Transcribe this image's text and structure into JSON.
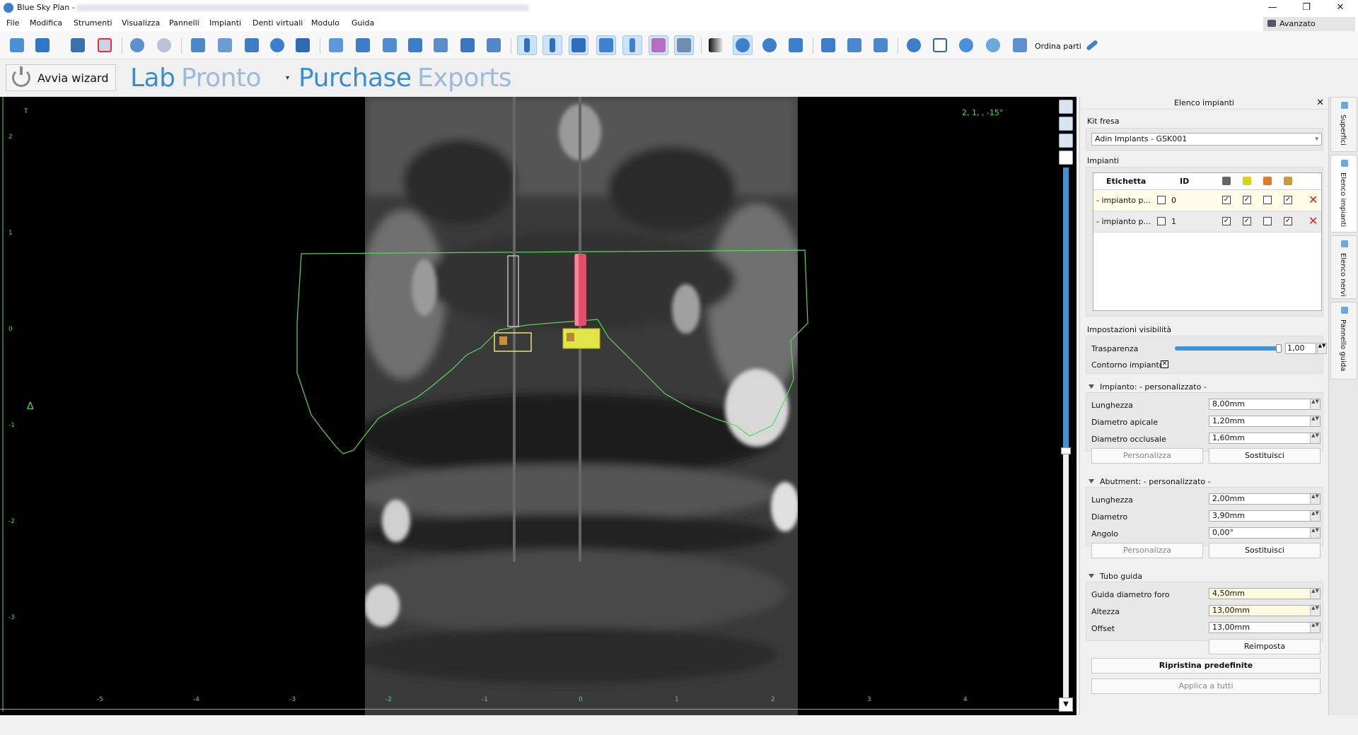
{
  "window": {
    "title": "Blue Sky Plan -",
    "minimize_glyph": "—",
    "restore_glyph": "❐",
    "close_glyph": "✕"
  },
  "menu": [
    "File",
    "Modifica",
    "Strumenti",
    "Visualizza",
    "Pannelli",
    "Impianti",
    "Denti virtuali",
    "Modulo",
    "Guida"
  ],
  "avanzato_label": "Avanzato",
  "toolbar": {
    "ordina_label": "Ordina parti"
  },
  "wizard": {
    "label": "Avvia wizard"
  },
  "brands": {
    "labpronto_a": "Lab",
    "labpronto_b": "Pronto",
    "purchase_a": "Purchase",
    "purchase_b": "Exports"
  },
  "viewport": {
    "view_label": "2, 1, , -15°",
    "axis_left_labels": [
      "2",
      "1",
      "0",
      "-1",
      "-2",
      "-3"
    ],
    "axis_left_top": "T",
    "axis_bottom_labels": [
      "-5",
      "-4",
      "-3",
      "-2",
      "-1",
      "0",
      "1",
      "2",
      "3",
      "4"
    ],
    "delta_marker": "Δ",
    "scroll_down_glyph": "▼",
    "accent_color": "#57d957"
  },
  "panel": {
    "title": "Elenco impianti",
    "close_glyph": "✕",
    "kit_label": "Kit fresa",
    "kit_value": "Adin Implants - GSK001",
    "impianti_label": "Impianti",
    "table_headers": {
      "label": "Etichetta",
      "id": "ID"
    },
    "implants": [
      {
        "label": "- impianto p...",
        "id": "0",
        "id_checked": false,
        "flags": [
          true,
          true,
          false,
          true
        ]
      },
      {
        "label": "- impianto p...",
        "id": "1",
        "id_checked": false,
        "flags": [
          true,
          true,
          false,
          true
        ]
      }
    ],
    "visibility_title": "Impostazioni visibilità",
    "trasparenza_label": "Trasparenza",
    "trasparenza_value": "1,00",
    "trasparenza_level": 0.98,
    "contorno_label": "Contorno impianto",
    "impianto_group": {
      "title": "Impianto: - personalizzato -",
      "rows": [
        {
          "label": "Lunghezza",
          "value": "8,00mm"
        },
        {
          "label": "Diametro apicale",
          "value": "1,20mm"
        },
        {
          "label": "Diametro occlusale",
          "value": "1,60mm"
        }
      ],
      "btn_personalizza": "Personalizza",
      "btn_sostituisci": "Sostituisci"
    },
    "abutment_group": {
      "title": "Abutment: - personalizzato -",
      "rows": [
        {
          "label": "Lunghezza",
          "value": "2,00mm"
        },
        {
          "label": "Diametro",
          "value": "3,90mm"
        },
        {
          "label": "Angolo",
          "value": "0,00°"
        }
      ],
      "btn_personalizza": "Personalizza",
      "btn_sostituisci": "Sostituisci"
    },
    "tubo_group": {
      "title": "Tubo guida",
      "rows": [
        {
          "label": "Guida diametro foro",
          "value": "4,50mm"
        },
        {
          "label": "Altezza",
          "value": "13,00mm"
        },
        {
          "label": "Offset",
          "value": "13,00mm"
        }
      ],
      "btn_reimposta": "Reimposta"
    },
    "btn_ripristina": "Ripristina predefinite",
    "btn_applica": "Applica a tutti"
  },
  "side_tabs": [
    "Superfici",
    "Elenco impianti",
    "Elenco nervi",
    "Pannello guida"
  ],
  "glyphs": {
    "check": "✓",
    "cross": "✕",
    "caret": "▾",
    "spin": "▲▼"
  }
}
